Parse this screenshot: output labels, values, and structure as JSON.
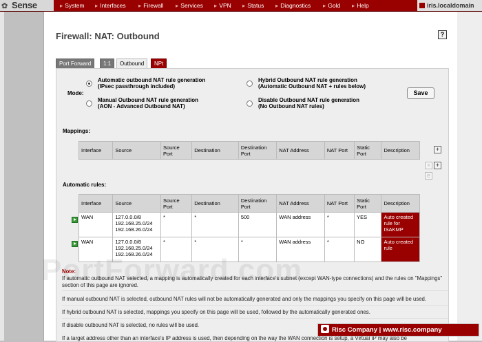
{
  "logo": {
    "text": "Sense"
  },
  "nav": [
    "System",
    "Interfaces",
    "Firewall",
    "Services",
    "VPN",
    "Status",
    "Diagnostics",
    "Gold",
    "Help"
  ],
  "host": "iris.localdomain",
  "page_title": "Firewall: NAT: Outbound",
  "tabs": [
    "Port Forward",
    "1:1",
    "Outbound",
    "NPt"
  ],
  "mode": {
    "label": "Mode:",
    "options": [
      {
        "title": "Automatic outbound NAT rule generation",
        "subtitle": "(IPsec passthrough included)"
      },
      {
        "title": "Hybrid Outbound NAT rule generation",
        "subtitle": "(Automatic Outbound NAT + rules below)"
      },
      {
        "title": "Manual Outbound NAT rule generation",
        "subtitle": "(AON - Advanced Outbound NAT)"
      },
      {
        "title": "Disable Outbound NAT rule generation",
        "subtitle": "(No Outbound NAT rules)"
      }
    ],
    "save_label": "Save"
  },
  "mappings": {
    "label": "Mappings:",
    "columns": [
      "Interface",
      "Source",
      "Source Port",
      "Destination",
      "Destination Port",
      "NAT Address",
      "NAT Port",
      "Static Port",
      "Description"
    ]
  },
  "auto_rules": {
    "label": "Automatic rules:",
    "columns": [
      "Interface",
      "Source",
      "Source Port",
      "Destination",
      "Destination Port",
      "NAT Address",
      "NAT Port",
      "Static Port",
      "Description"
    ],
    "rows": [
      {
        "interface": "WAN",
        "source": [
          "127.0.0.0/8",
          "192.168.25.0/24",
          "192.168.26.0/24"
        ],
        "source_port": "*",
        "destination": "*",
        "destination_port": "500",
        "nat_address": "WAN address",
        "nat_port": "*",
        "static_port": "YES",
        "description": "Auto created rule for ISAKMP"
      },
      {
        "interface": "WAN",
        "source": [
          "127.0.0.0/8",
          "192.168.25.0/24",
          "192.168.26.0/24"
        ],
        "source_port": "*",
        "destination": "*",
        "destination_port": "*",
        "nat_address": "WAN address",
        "nat_port": "*",
        "static_port": "NO",
        "description": "Auto created rule"
      }
    ]
  },
  "notes": {
    "heading": "Note:",
    "lines": [
      "If automatic outbound NAT selected, a mapping is automatically created for each interface's subnet (except WAN-type connections) and the rules on \"Mappings\" section of this page are ignored.",
      "If manual outbound NAT is selected, outbound NAT rules will not be automatically generated and only the mappings you specify on this page will be used.",
      "If hybrid outbound NAT is selected, mappings you specify on this page will be used, followed by the automatically generated ones.",
      "If disable outbound NAT is selected, no rules will be used.",
      "If a target address other than an interface's IP address is used, then depending on the way the WAN connection is setup, a Virtual IP may also be"
    ]
  },
  "watermark": "PortForward.com",
  "banner": "Risc Company | www.risc.company",
  "colors": {
    "brand": "#990000",
    "panel": "#eeeeee",
    "header_cell": "#d6d6d6"
  }
}
